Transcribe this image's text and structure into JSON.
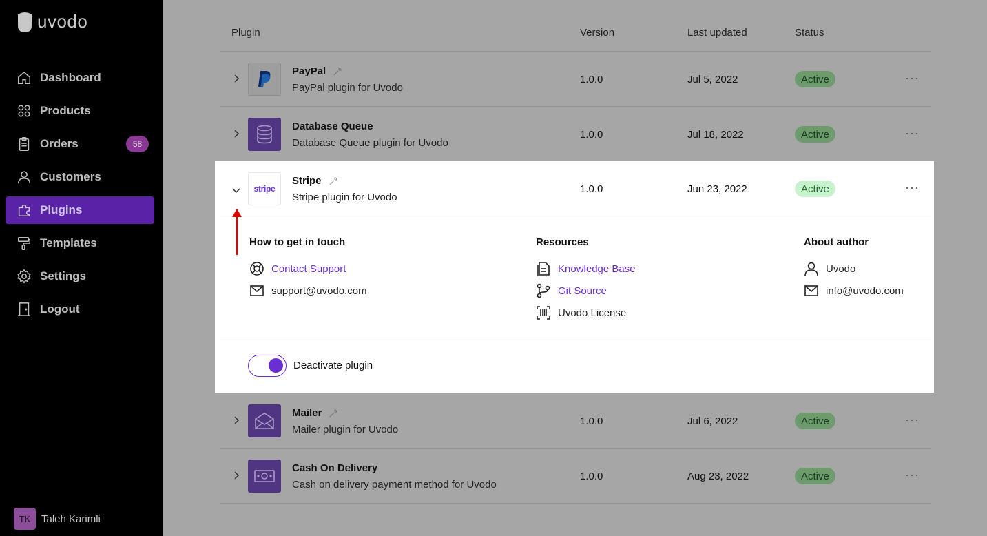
{
  "sidebar": {
    "logo": "uvodo",
    "items": [
      {
        "label": "Dashboard",
        "icon": "home-icon"
      },
      {
        "label": "Products",
        "icon": "grid-icon"
      },
      {
        "label": "Orders",
        "icon": "clipboard-icon",
        "badge": "58"
      },
      {
        "label": "Customers",
        "icon": "user-icon"
      },
      {
        "label": "Plugins",
        "icon": "puzzle-icon",
        "active": true
      },
      {
        "label": "Templates",
        "icon": "paint-roller-icon"
      },
      {
        "label": "Settings",
        "icon": "gear-icon"
      },
      {
        "label": "Logout",
        "icon": "door-icon"
      }
    ],
    "user": {
      "initials": "TK",
      "name": "Taleh Karimli"
    }
  },
  "table": {
    "headers": {
      "plugin": "Plugin",
      "version": "Version",
      "updated": "Last updated",
      "status": "Status"
    },
    "rows": [
      {
        "name": "PayPal",
        "desc": "PayPal plugin for Uvodo",
        "version": "1.0.0",
        "updated": "Jul 5, 2022",
        "status": "Active",
        "more": "···"
      },
      {
        "name": "Database Queue",
        "desc": "Database Queue plugin for Uvodo",
        "version": "1.0.0",
        "updated": "Jul 18, 2022",
        "status": "Active",
        "more": "···"
      },
      {
        "name": "Stripe",
        "desc": "Stripe plugin for Uvodo",
        "version": "1.0.0",
        "updated": "Jun 23, 2022",
        "status": "Active",
        "more": "···",
        "logo_text": "stripe"
      },
      {
        "name": "Mailer",
        "desc": "Mailer plugin for Uvodo",
        "version": "1.0.0",
        "updated": "Jul 6, 2022",
        "status": "Active",
        "more": "···"
      },
      {
        "name": "Cash On Delivery",
        "desc": "Cash on delivery payment method for Uvodo",
        "version": "1.0.0",
        "updated": "Aug 23, 2022",
        "status": "Active",
        "more": "···"
      }
    ]
  },
  "details": {
    "contact": {
      "title": "How to get in touch",
      "support": "Contact Support",
      "email": "support@uvodo.com"
    },
    "resources": {
      "title": "Resources",
      "kb": "Knowledge Base",
      "git": "Git Source",
      "license": "Uvodo License"
    },
    "author": {
      "title": "About author",
      "name": "Uvodo",
      "email": "info@uvodo.com"
    },
    "toggle_label": "Deactivate plugin"
  },
  "colors": {
    "accent": "#6a2fd0",
    "active_bg": "#c9f2cf",
    "active_text": "#206b2b",
    "annotation": "#e00000"
  }
}
